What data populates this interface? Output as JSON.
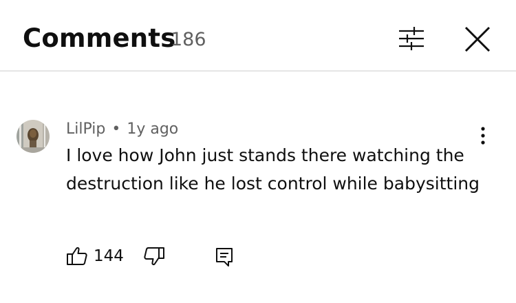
{
  "header": {
    "title": "Comments",
    "count": "186",
    "icons": {
      "filter": "sliders-icon",
      "close": "close-icon"
    }
  },
  "comment": {
    "author": "LilPip",
    "separator": "•",
    "time": "1y ago",
    "text": "I love how John just stands there watching the destruction like he lost control while babysitting",
    "likes": "144",
    "icons": {
      "avatar": "avatar",
      "more": "more-vertical-icon",
      "like": "thumbs-up-icon",
      "dislike": "thumbs-down-icon",
      "reply": "reply-icon"
    }
  },
  "colors": {
    "primary_text": "#0f0f0f",
    "secondary_text": "#606060",
    "divider": "#e5e5e5",
    "background": "#ffffff"
  }
}
